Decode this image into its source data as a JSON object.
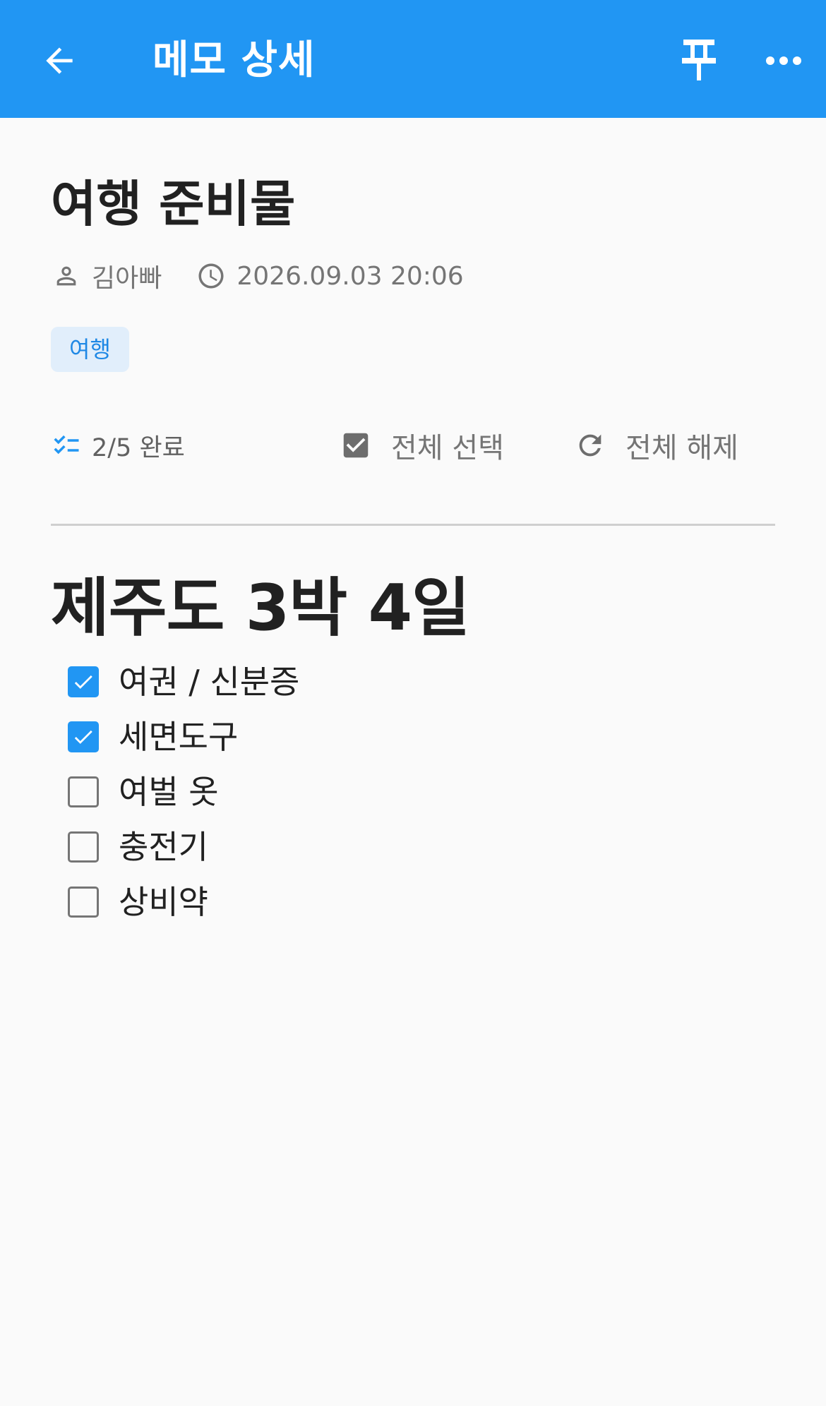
{
  "colors": {
    "app_bar": "#2196f3",
    "accent": "#2196f3",
    "tag_background": "#e1eefb",
    "tag_text": "#1e88e5",
    "background": "#fafafa"
  },
  "app_bar": {
    "back_icon": "arrow-left-icon",
    "title": "메모 상세",
    "pin_icon": "pushpin-icon",
    "more_icon": "more-horizontal-icon"
  },
  "memo": {
    "title": "여행 준비물",
    "author_icon": "person-icon",
    "author": "김아빠",
    "time_icon": "clock-icon",
    "datetime": "2026.09.03 20:06",
    "tags": [
      "여행"
    ]
  },
  "actions": {
    "progress_icon": "checklist-icon",
    "progress_text": "2/5 완료",
    "select_all_icon": "checkbox-checked-icon",
    "select_all_label": "전체 선택",
    "clear_all_icon": "refresh-icon",
    "clear_all_label": "전체 해제"
  },
  "section": {
    "title": "제주도 3박 4일"
  },
  "checklist": [
    {
      "label": "여권 / 신분증",
      "checked": true
    },
    {
      "label": "세면도구",
      "checked": true
    },
    {
      "label": "여벌 옷",
      "checked": false
    },
    {
      "label": "충전기",
      "checked": false
    },
    {
      "label": "상비약",
      "checked": false
    }
  ]
}
